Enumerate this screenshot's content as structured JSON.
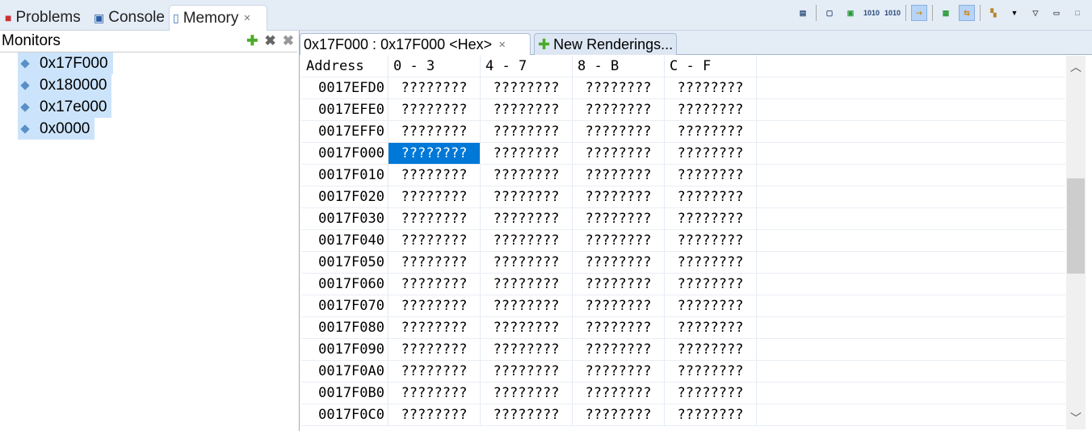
{
  "view_tabs": [
    {
      "label": "Problems",
      "icon": "problems-icon"
    },
    {
      "label": "Console",
      "icon": "console-icon"
    },
    {
      "label": "Memory",
      "icon": "memory-icon",
      "active": true
    }
  ],
  "toolbar": [
    "copy-icon",
    "new-tab-icon",
    "pin-icon",
    "bytes-left-icon",
    "bytes-right-icon",
    "link-icon",
    "columns-icon",
    "swap-icon",
    "layout-icon",
    "menu-icon",
    "view-menu-icon",
    "minimize-icon",
    "maximize-icon"
  ],
  "monitors": {
    "title": "Monitors",
    "items": [
      "0x17F000",
      "0x180000",
      "0x17e000",
      "0x0000"
    ]
  },
  "rendering": {
    "tab_label": "0x17F000 : 0x17F000 <Hex>",
    "new_label": "New Renderings..."
  },
  "table": {
    "headers": [
      "Address",
      "0 - 3",
      "4 - 7",
      "8 - B",
      "C - F"
    ],
    "addresses": [
      "0017EFD0",
      "0017EFE0",
      "0017EFF0",
      "0017F000",
      "0017F010",
      "0017F020",
      "0017F030",
      "0017F040",
      "0017F050",
      "0017F060",
      "0017F070",
      "0017F080",
      "0017F090",
      "0017F0A0",
      "0017F0B0",
      "0017F0C0"
    ],
    "cell_value": "????????",
    "selected": {
      "row": 3,
      "col": 0
    }
  },
  "colors": {
    "selection": "#0078d7",
    "monitor_highlight": "#cce4fb"
  }
}
